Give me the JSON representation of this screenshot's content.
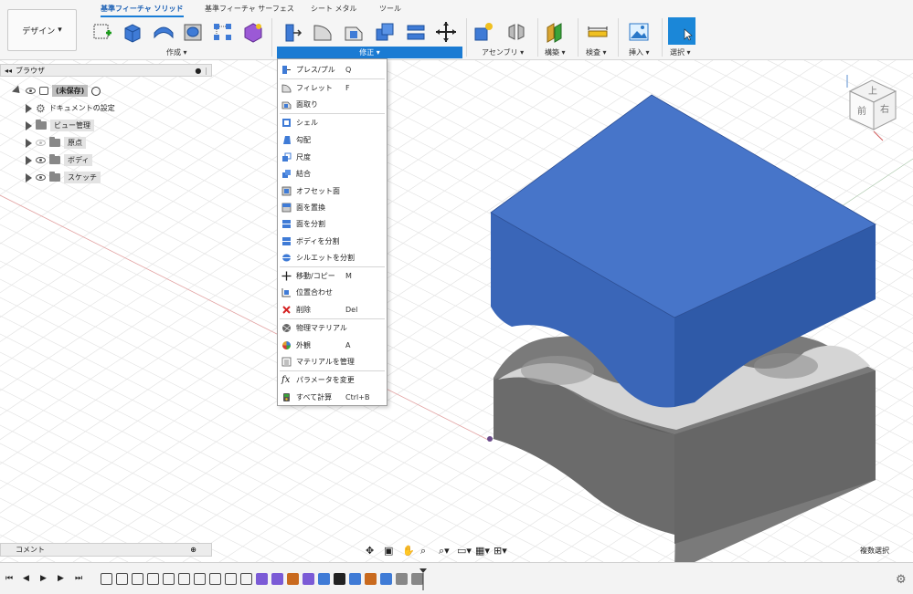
{
  "ribbon": {
    "design_label": "デザイン",
    "tabs": [
      {
        "label": "基準フィーチャ ソリッド",
        "active": true
      },
      {
        "label": "基準フィーチャ サーフェス",
        "active": false
      },
      {
        "label": "シート メタル",
        "active": false
      },
      {
        "label": "ツール",
        "active": false
      }
    ],
    "groups": {
      "create": "作成 ▾",
      "modify": "修正 ▾",
      "assembly": "アセンブリ ▾",
      "construct": "構築 ▾",
      "inspect": "検査 ▾",
      "insert": "挿入 ▾",
      "select": "選択 ▾"
    }
  },
  "browser": {
    "title": "ブラウザ",
    "root": "(未保存)",
    "items": [
      {
        "label": "ドキュメントの設定",
        "icon": "gear-icon"
      },
      {
        "label": "ビュー管理",
        "icon": "folder-icon"
      },
      {
        "label": "原点",
        "icon": "folder-icon"
      },
      {
        "label": "ボディ",
        "icon": "folder-icon"
      },
      {
        "label": "スケッチ",
        "icon": "folder-icon"
      }
    ]
  },
  "modify_menu": {
    "items": [
      {
        "label": "プレス/プル",
        "shortcut": "Q",
        "icon": "press-pull-icon"
      },
      {
        "label": "フィレット",
        "shortcut": "F",
        "icon": "fillet-icon"
      },
      {
        "label": "面取り",
        "shortcut": "",
        "icon": "chamfer-icon"
      },
      {
        "label": "シェル",
        "shortcut": "",
        "icon": "shell-icon"
      },
      {
        "label": "勾配",
        "shortcut": "",
        "icon": "draft-icon"
      },
      {
        "label": "尺度",
        "shortcut": "",
        "icon": "scale-icon"
      },
      {
        "label": "結合",
        "shortcut": "",
        "icon": "combine-icon"
      },
      {
        "label": "オフセット面",
        "shortcut": "",
        "icon": "offset-face-icon"
      },
      {
        "label": "面を置換",
        "shortcut": "",
        "icon": "replace-face-icon"
      },
      {
        "label": "面を分割",
        "shortcut": "",
        "icon": "split-face-icon"
      },
      {
        "label": "ボディを分割",
        "shortcut": "",
        "icon": "split-body-icon"
      },
      {
        "label": "シルエットを分割",
        "shortcut": "",
        "icon": "silhouette-split-icon"
      },
      {
        "label": "移動/コピー",
        "shortcut": "M",
        "icon": "move-icon"
      },
      {
        "label": "位置合わせ",
        "shortcut": "",
        "icon": "align-icon"
      },
      {
        "label": "削除",
        "shortcut": "Del",
        "icon": "delete-icon"
      },
      {
        "label": "物理マテリアル",
        "shortcut": "",
        "icon": "physical-material-icon"
      },
      {
        "label": "外観",
        "shortcut": "A",
        "icon": "appearance-icon"
      },
      {
        "label": "マテリアルを管理",
        "shortcut": "",
        "icon": "manage-materials-icon"
      },
      {
        "label": "パラメータを変更",
        "shortcut": "",
        "icon": "change-parameters-icon"
      },
      {
        "label": "すべて計算",
        "shortcut": "Ctrl+B",
        "icon": "compute-all-icon"
      }
    ]
  },
  "viewcube": {
    "top": "上",
    "front": "前",
    "right": "右"
  },
  "comment": {
    "label": "コメント"
  },
  "status": {
    "multi_select": "複数選択"
  },
  "colors": {
    "accent": "#1b7bd3",
    "body_blue": "#3f6fc4",
    "base_gray": "#6e6e6e"
  }
}
